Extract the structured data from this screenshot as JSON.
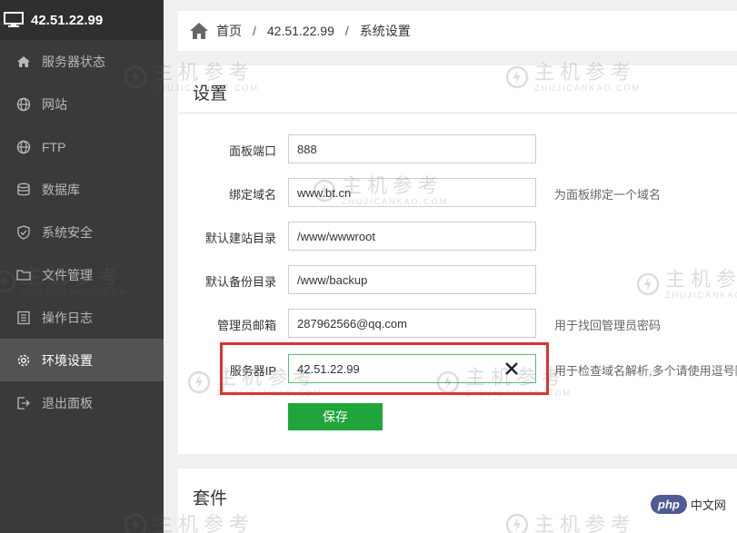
{
  "sidebar": {
    "host": "42.51.22.99",
    "items": [
      {
        "label": "服务器状态",
        "icon": "home-icon"
      },
      {
        "label": "网站",
        "icon": "globe-icon"
      },
      {
        "label": "FTP",
        "icon": "ftp-globe-icon"
      },
      {
        "label": "数据库",
        "icon": "database-icon"
      },
      {
        "label": "系统安全",
        "icon": "shield-icon"
      },
      {
        "label": "文件管理",
        "icon": "folder-icon"
      },
      {
        "label": "操作日志",
        "icon": "log-icon"
      },
      {
        "label": "环境设置",
        "icon": "gear-icon"
      },
      {
        "label": "退出面板",
        "icon": "logout-icon"
      }
    ]
  },
  "breadcrumb": {
    "home": "首页",
    "host": "42.51.22.99",
    "current": "系统设置"
  },
  "settings": {
    "title": "设置",
    "fields": [
      {
        "label": "面板端口",
        "value": "888",
        "hint": ""
      },
      {
        "label": "绑定域名",
        "value": "www.bt.cn",
        "hint": "为面板绑定一个域名"
      },
      {
        "label": "默认建站目录",
        "value": "/www/wwwroot",
        "hint": ""
      },
      {
        "label": "默认备份目录",
        "value": "/www/backup",
        "hint": ""
      },
      {
        "label": "管理员邮箱",
        "value": "287962566@qq.com",
        "hint": "用于找回管理员密码"
      },
      {
        "label": "服务器IP",
        "value": "42.51.22.99",
        "hint": "用于检查域名解析,多个请使用逗号隔"
      }
    ],
    "save_label": "保存"
  },
  "suite": {
    "title": "套件"
  },
  "watermark": {
    "cn": "主机参考",
    "en": "ZHUJICANKAO.COM"
  },
  "php_badge": {
    "php": "php",
    "cn": "中文网"
  },
  "colors": {
    "sidebar_bg": "#3a3a3a",
    "active_bg": "#535353",
    "save_green": "#20a53a",
    "highlight_red": "#e03131"
  }
}
